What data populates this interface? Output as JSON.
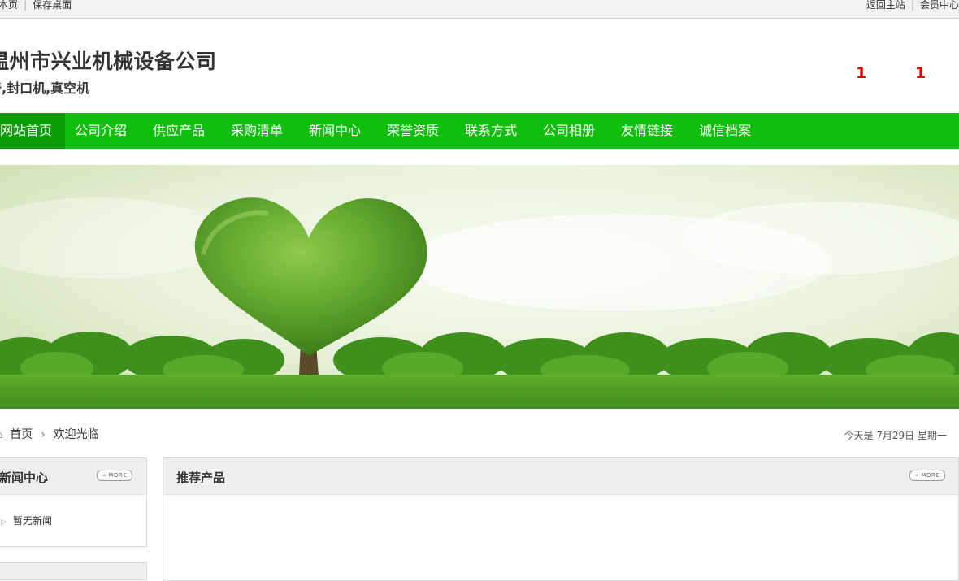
{
  "topbar": {
    "left_links": [
      "藏本页",
      "保存桌面"
    ],
    "right_links": [
      "返回主站",
      "会员中心"
    ]
  },
  "header": {
    "company_name": "温州市兴业机械设备公司",
    "tagline": "奇,封口机,真空机",
    "numbers": [
      "1",
      "1"
    ]
  },
  "nav": {
    "items": [
      "网站首页",
      "公司介绍",
      "供应产品",
      "采购清单",
      "新闻中心",
      "荣誉资质",
      "联系方式",
      "公司相册",
      "友情链接",
      "诚信档案"
    ],
    "active_index": 0
  },
  "breadcrumb": {
    "home": "首页",
    "current": "欢迎光临"
  },
  "date_text": "今天是 7月29日 星期一",
  "news_box": {
    "title": "新闻中心",
    "more": "» MORE",
    "empty_text": "暂无新闻"
  },
  "products_box": {
    "title": "推荐产品",
    "more": "» MORE"
  },
  "colors": {
    "nav_bg": "#10be0e",
    "nav_active": "#0c9e0a",
    "number_red": "#e00000"
  },
  "icons": [
    "home-icon",
    "chevron-right-icon",
    "triangle-right-icon"
  ]
}
